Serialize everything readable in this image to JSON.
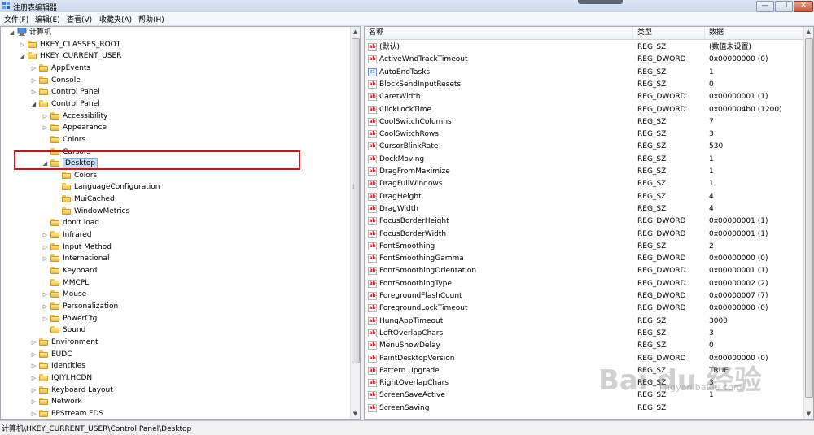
{
  "window": {
    "title": "注册表编辑器",
    "buttons": {
      "minimize": "—",
      "maximize": "❐",
      "close": "✕"
    }
  },
  "menu": [
    "文件(F)",
    "编辑(E)",
    "查看(V)",
    "收藏夹(A)",
    "帮助(H)"
  ],
  "tree": {
    "root": "计算机",
    "hkcr": "HKEY_CLASSES_ROOT",
    "hkcu": "HKEY_CURRENT_USER",
    "hkcu_children": [
      "AppEvents",
      "Console",
      "Control  Panel"
    ],
    "control_panel": "Control Panel",
    "cp_children_before": [
      "Accessibility",
      "Appearance",
      "Colors",
      "Cursors"
    ],
    "selected": "Desktop",
    "desktop_children": [
      "Colors",
      "LanguageConfiguration",
      "MuiCached",
      "WindowMetrics"
    ],
    "cp_children_after": [
      "don't load",
      "Infrared",
      "Input Method",
      "International",
      "Keyboard",
      "MMCPL",
      "Mouse",
      "Personalization",
      "PowerCfg",
      "Sound"
    ],
    "hkcu_more": [
      "Environment",
      "EUDC",
      "Identities",
      "IQIYI.HCDN",
      "Keyboard Layout",
      "Network",
      "PPStream.FDS"
    ]
  },
  "list": {
    "columns": [
      "名称",
      "类型",
      "数据"
    ],
    "rows": [
      {
        "name": "(默认)",
        "type": "REG_SZ",
        "data": "(数值未设置)",
        "icon": "string-value-icon"
      },
      {
        "name": "ActiveWndTrackTimeout",
        "type": "REG_DWORD",
        "data": "0x00000000 (0)",
        "icon": "string-value-icon"
      },
      {
        "name": "AutoEndTasks",
        "type": "REG_SZ",
        "data": "1",
        "icon": "binary-value-icon"
      },
      {
        "name": "BlockSendInputResets",
        "type": "REG_SZ",
        "data": "0",
        "icon": "string-value-icon"
      },
      {
        "name": "CaretWidth",
        "type": "REG_DWORD",
        "data": "0x00000001 (1)",
        "icon": "string-value-icon"
      },
      {
        "name": "ClickLockTime",
        "type": "REG_DWORD",
        "data": "0x000004b0 (1200)",
        "icon": "string-value-icon"
      },
      {
        "name": "CoolSwitchColumns",
        "type": "REG_SZ",
        "data": "7",
        "icon": "string-value-icon"
      },
      {
        "name": "CoolSwitchRows",
        "type": "REG_SZ",
        "data": "3",
        "icon": "string-value-icon"
      },
      {
        "name": "CursorBlinkRate",
        "type": "REG_SZ",
        "data": "530",
        "icon": "string-value-icon"
      },
      {
        "name": "DockMoving",
        "type": "REG_SZ",
        "data": "1",
        "icon": "string-value-icon"
      },
      {
        "name": "DragFromMaximize",
        "type": "REG_SZ",
        "data": "1",
        "icon": "string-value-icon"
      },
      {
        "name": "DragFullWindows",
        "type": "REG_SZ",
        "data": "1",
        "icon": "string-value-icon"
      },
      {
        "name": "DragHeight",
        "type": "REG_SZ",
        "data": "4",
        "icon": "string-value-icon"
      },
      {
        "name": "DragWidth",
        "type": "REG_SZ",
        "data": "4",
        "icon": "string-value-icon"
      },
      {
        "name": "FocusBorderHeight",
        "type": "REG_DWORD",
        "data": "0x00000001 (1)",
        "icon": "string-value-icon"
      },
      {
        "name": "FocusBorderWidth",
        "type": "REG_DWORD",
        "data": "0x00000001 (1)",
        "icon": "string-value-icon"
      },
      {
        "name": "FontSmoothing",
        "type": "REG_SZ",
        "data": "2",
        "icon": "string-value-icon"
      },
      {
        "name": "FontSmoothingGamma",
        "type": "REG_DWORD",
        "data": "0x00000000 (0)",
        "icon": "string-value-icon"
      },
      {
        "name": "FontSmoothingOrientation",
        "type": "REG_DWORD",
        "data": "0x00000001 (1)",
        "icon": "string-value-icon"
      },
      {
        "name": "FontSmoothingType",
        "type": "REG_DWORD",
        "data": "0x00000002 (2)",
        "icon": "string-value-icon"
      },
      {
        "name": "ForegroundFlashCount",
        "type": "REG_DWORD",
        "data": "0x00000007 (7)",
        "icon": "string-value-icon"
      },
      {
        "name": "ForegroundLockTimeout",
        "type": "REG_DWORD",
        "data": "0x00000000 (0)",
        "icon": "string-value-icon"
      },
      {
        "name": "HungAppTimeout",
        "type": "REG_SZ",
        "data": "3000",
        "icon": "string-value-icon"
      },
      {
        "name": "LeftOverlapChars",
        "type": "REG_SZ",
        "data": "3",
        "icon": "string-value-icon"
      },
      {
        "name": "MenuShowDelay",
        "type": "REG_SZ",
        "data": "0",
        "icon": "string-value-icon"
      },
      {
        "name": "PaintDesktopVersion",
        "type": "REG_DWORD",
        "data": "0x00000000 (0)",
        "icon": "string-value-icon"
      },
      {
        "name": "Pattern Upgrade",
        "type": "REG_SZ",
        "data": "TRUE",
        "icon": "string-value-icon"
      },
      {
        "name": "RightOverlapChars",
        "type": "REG_SZ",
        "data": "3",
        "icon": "string-value-icon"
      },
      {
        "name": "ScreenSaveActive",
        "type": "REG_SZ",
        "data": "1",
        "icon": "string-value-icon"
      },
      {
        "name": "ScreenSaving",
        "type": "REG_SZ",
        "data": "",
        "icon": "string-value-icon"
      }
    ]
  },
  "status": "计算机\\HKEY_CURRENT_USER\\Control Panel\\Desktop",
  "watermark": {
    "text": "Bai du 经验",
    "sub": "jingyan.baidu.com"
  },
  "colors": {
    "highlight_box": "#d0121a",
    "selection": "#c7dffc"
  }
}
